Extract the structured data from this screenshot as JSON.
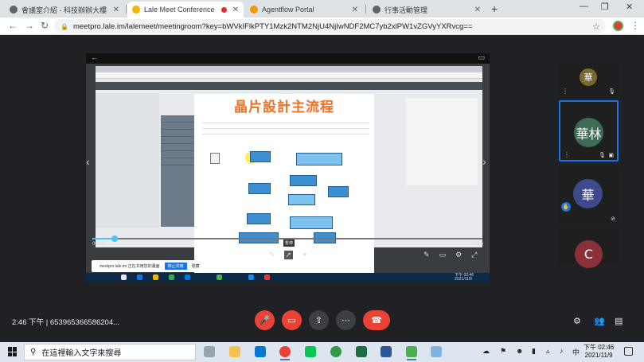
{
  "browser": {
    "tabs": [
      {
        "title": "會議室介紹 - 科技辦辦大樓",
        "active": false
      },
      {
        "title": "Lale Meet Conference",
        "active": true
      },
      {
        "title": "Agentflow Portal",
        "active": false
      },
      {
        "title": "行事活動管理",
        "active": false
      }
    ],
    "url": "meetpro.lale.im/lalemeet/meetingroom?key=bWVkIFlkPTY1Mzk2NTM2NjU4NjIwNDF2MC7yb2xlPW1vZGVyYXRvcg=="
  },
  "stage": {
    "slide_title": "晶片設計主流程",
    "time_elapsed": "00:00",
    "time_total": "00:26",
    "tooltip": "暫停",
    "share_prompt": "meetpro.lale.im 正在共用您的畫面",
    "share_stop": "停止共用",
    "share_hide": "隱藏",
    "inner_clock_time": "下午 02:46",
    "inner_clock_date": "2021/11/9"
  },
  "participants": [
    {
      "initial": "華",
      "color": "#7a6a2a"
    },
    {
      "initial": "華林",
      "color": "#3d6b55"
    },
    {
      "initial": "華",
      "color": "#3f4a8c"
    },
    {
      "initial": "C",
      "color": "#8b2f3a"
    }
  ],
  "callbar": {
    "meeting_info": "2:46 下午 | 653965366586204...",
    "icons": [
      "mic-off-icon",
      "camera-off-icon",
      "present-icon",
      "more-icon",
      "end-call-icon"
    ]
  },
  "taskbar": {
    "search_placeholder": "在這裡輸入文字來搜尋",
    "time": "下午 02:46",
    "date": "2021/11/9",
    "ime": "中"
  }
}
